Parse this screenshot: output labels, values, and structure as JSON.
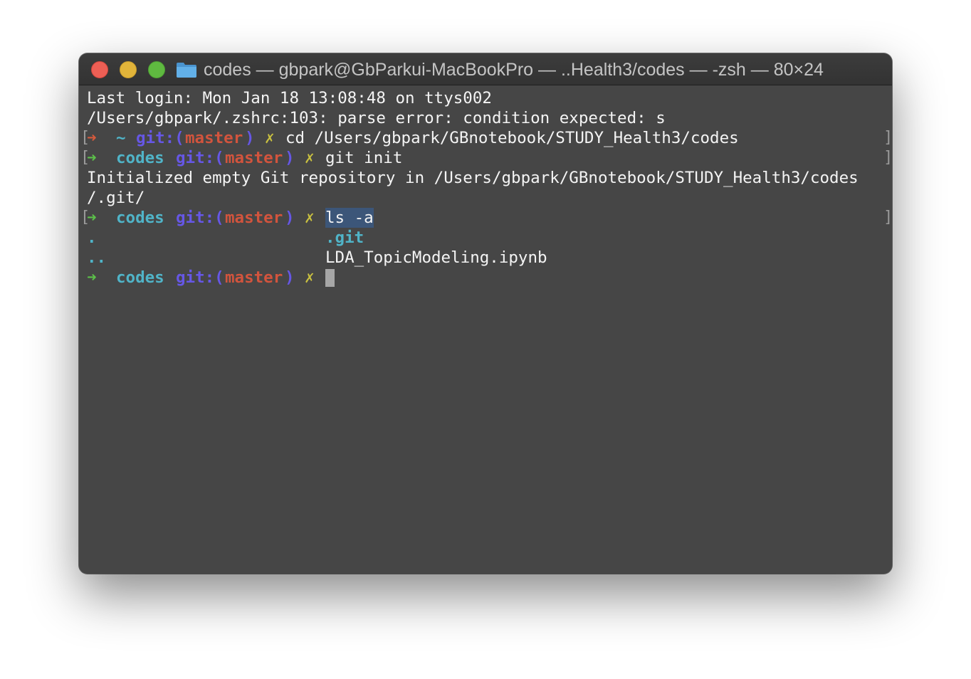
{
  "window": {
    "title": "codes — gbpark@GbParkui-MacBookPro — ..Health3/codes — -zsh — 80×24",
    "icons": [
      "close-button",
      "minimize-button",
      "zoom-button",
      "folder-icon"
    ],
    "colors": {
      "background": "#464646",
      "titlebar": "#383838",
      "close": "#ed5f55",
      "minimize": "#e1b43a",
      "zoom": "#5fb940",
      "folder": "#5aa8e0",
      "selection": "#3c5679"
    }
  },
  "terminal": {
    "last_login": "Last login: Mon Jan 18 13:08:48 on ttys002",
    "parse_error": "/Users/gbpark/.zshrc:103: parse error: condition expected: s",
    "marker_left": "[",
    "marker_right": "]",
    "prompt_arrow": "➜",
    "prompt_git_open": "git:(",
    "prompt_branch": "master",
    "prompt_git_close": ")",
    "prompt_dirty": "✗",
    "line1": {
      "dir": "~",
      "command": "cd /Users/gbpark/GBnotebook/STUDY_Health3/codes"
    },
    "line2": {
      "dir": "codes",
      "command": "git init"
    },
    "init_output_1": "Initialized empty Git repository in /Users/gbpark/GBnotebook/STUDY_Health3/codes",
    "init_output_2": "/.git/",
    "line3": {
      "dir": "codes",
      "command": "ls -a"
    },
    "ls_output": {
      "col1_row1": ".",
      "col2_row1": ".git",
      "col1_row2": "..",
      "col2_row2": "LDA_TopicModeling.ipynb"
    },
    "line4": {
      "dir": "codes"
    }
  }
}
